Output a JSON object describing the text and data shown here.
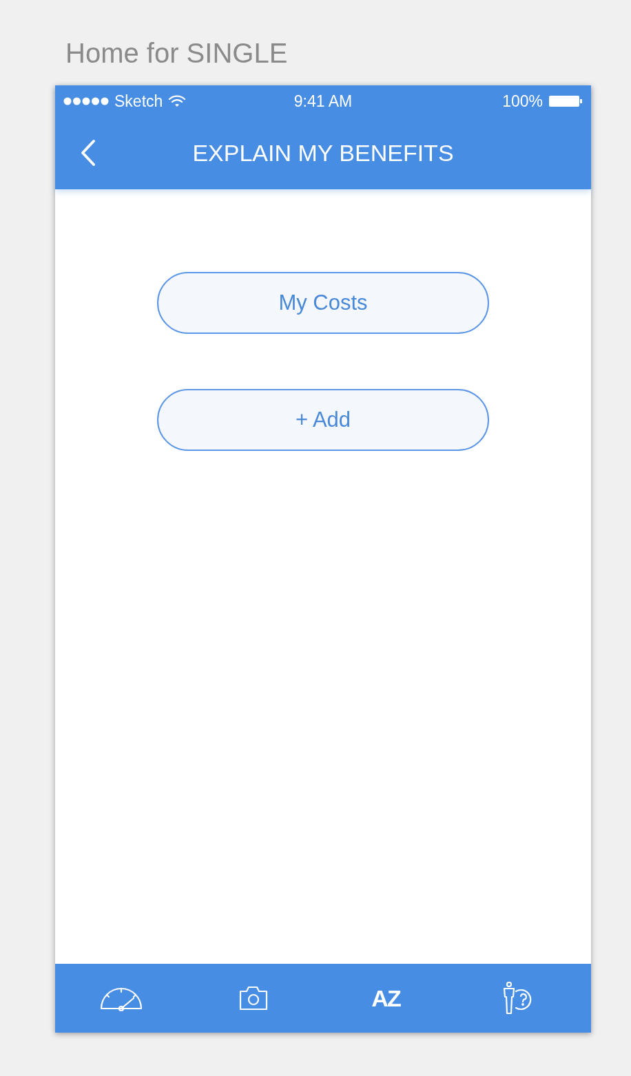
{
  "artboard_title": "Home for SINGLE",
  "status_bar": {
    "carrier": "Sketch",
    "time": "9:41 AM",
    "battery": "100%"
  },
  "nav_bar": {
    "title": "EXPLAIN MY BENEFITS"
  },
  "buttons": [
    {
      "label": "My Costs"
    },
    {
      "label": "+ Add"
    }
  ],
  "tab_bar": [
    {
      "kind": "gauge"
    },
    {
      "kind": "camera"
    },
    {
      "kind": "sort",
      "glyph": "AZ"
    },
    {
      "kind": "help"
    }
  ]
}
